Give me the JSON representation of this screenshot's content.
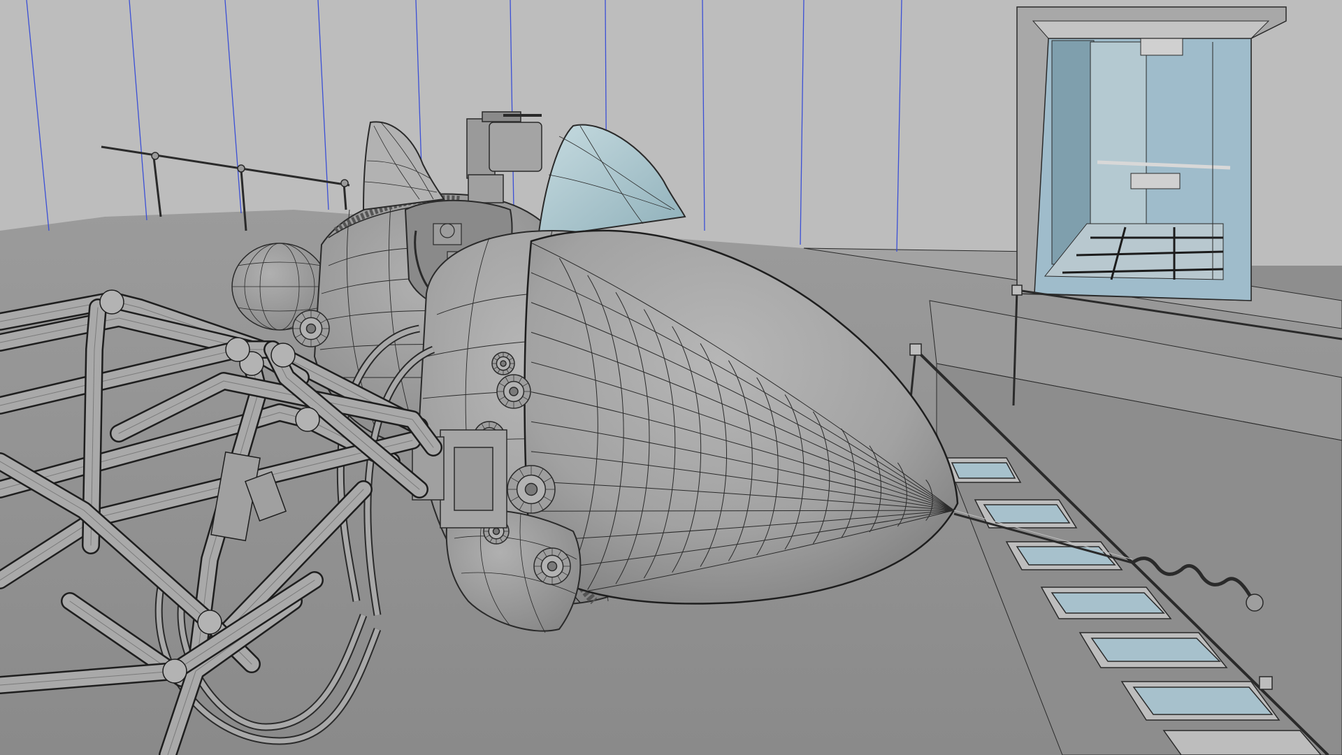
{
  "viewport": {
    "kind": "3d-wireframe-shaded-render",
    "subject": "mini-submarine-with-tubular-frame",
    "colors": {
      "wall": "#b9b9b9",
      "floor": "#8f8f8f",
      "floor_far": "#9a9a9a",
      "hull": "#a7a7a7",
      "hull_shadow": "#7d7d7d",
      "wire": "#2a2a2a",
      "guide_line": "#3b4fd6",
      "glass": "#a9c4cc",
      "door_glass": "#9fbccb",
      "stair_glass": "#a7c1cc"
    }
  }
}
